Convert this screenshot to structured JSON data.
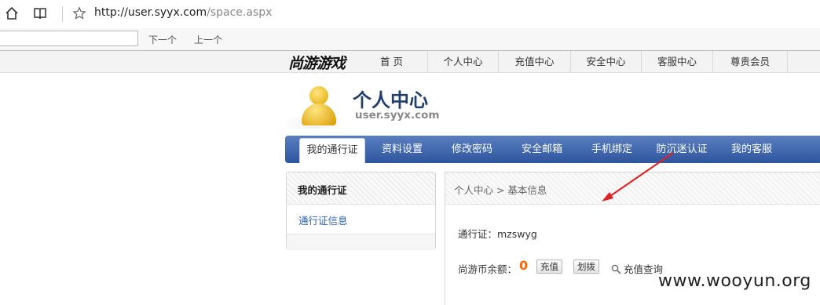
{
  "browser": {
    "url_host": "http://user.syyx.com",
    "url_path": "/space.aspx",
    "icons": [
      "home-icon",
      "reading-view-icon",
      "favorite-star-icon"
    ]
  },
  "findbar": {
    "query": "",
    "next_label": "下一个",
    "prev_label": "上一个"
  },
  "site": {
    "logo": "尚游游戏",
    "nav": [
      "首 页",
      "个人中心",
      "充值中心",
      "安全中心",
      "客服中心",
      "尊贵会员"
    ]
  },
  "user_header": {
    "title": "个人中心",
    "subtitle": "user.syyx.com"
  },
  "tabs": {
    "items": [
      "我的通行证",
      "资料设置",
      "修改密码",
      "安全邮箱",
      "手机绑定",
      "防沉迷认证",
      "我的客服"
    ],
    "active_index": 0
  },
  "sidebar": {
    "title": "我的通行证",
    "link": "通行证信息"
  },
  "main": {
    "breadcrumb": "个人中心 > 基本信息",
    "pass_label": "通行证：mzswyg",
    "coin_label": "尚游币余额：",
    "coin_value": "0",
    "recharge_button": "充值",
    "transfer_button": "划拨",
    "query_link": "充值查询"
  },
  "annotation": {
    "arrow_color": "#e02020"
  },
  "watermark": "www.wooyun.org",
  "colors": {
    "tab_bar": "#3a63ad",
    "title": "#1f3f6f",
    "link": "#2c63b1",
    "coin": "#ff6600"
  }
}
